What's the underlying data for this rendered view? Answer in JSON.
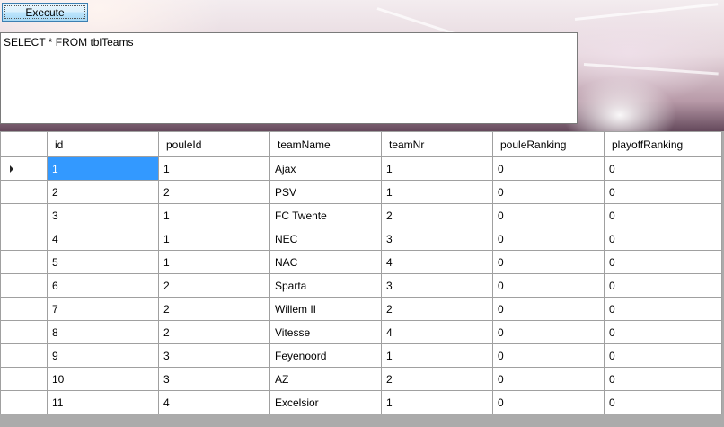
{
  "toolbar": {
    "execute_label": "Execute"
  },
  "query": {
    "text": "SELECT * FROM tblTeams"
  },
  "grid": {
    "columns": [
      "id",
      "pouleId",
      "teamName",
      "teamNr",
      "pouleRanking",
      "playoffRanking"
    ],
    "rows": [
      [
        "1",
        "1",
        "Ajax",
        "1",
        "0",
        "0"
      ],
      [
        "2",
        "2",
        "PSV",
        "1",
        "0",
        "0"
      ],
      [
        "3",
        "1",
        "FC Twente",
        "2",
        "0",
        "0"
      ],
      [
        "4",
        "1",
        "NEC",
        "3",
        "0",
        "0"
      ],
      [
        "5",
        "1",
        "NAC",
        "4",
        "0",
        "0"
      ],
      [
        "6",
        "2",
        "Sparta",
        "3",
        "0",
        "0"
      ],
      [
        "7",
        "2",
        "Willem II",
        "2",
        "0",
        "0"
      ],
      [
        "8",
        "2",
        "Vitesse",
        "4",
        "0",
        "0"
      ],
      [
        "9",
        "3",
        "Feyenoord",
        "1",
        "0",
        "0"
      ],
      [
        "10",
        "3",
        "AZ",
        "2",
        "0",
        "0"
      ],
      [
        "11",
        "4",
        "Excelsior",
        "1",
        "0",
        "0"
      ]
    ],
    "current_row_icon": "current-row-arrow-icon",
    "selection_color": "#3399ff"
  }
}
